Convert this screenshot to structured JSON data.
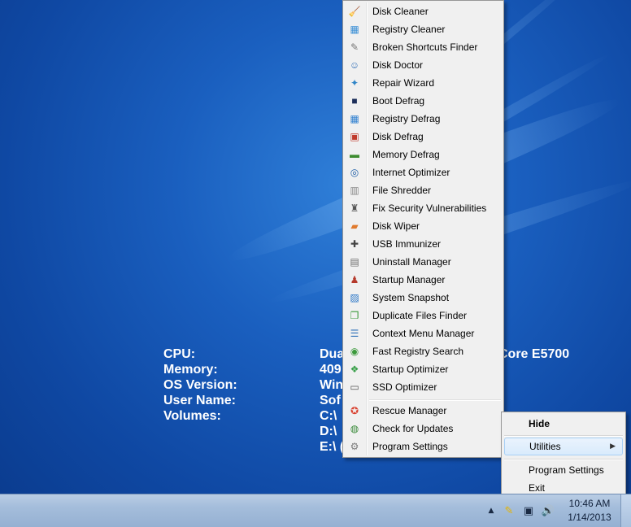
{
  "sysinfo": {
    "rows": [
      {
        "label": "CPU:",
        "value": "Dua",
        "tail": "Core    E5700"
      },
      {
        "label": "Memory:",
        "value": "409"
      },
      {
        "label": "OS Version:",
        "value": "Win"
      },
      {
        "label": "User Name:",
        "value": "Sof"
      },
      {
        "label": "Volumes:",
        "value": "C:\\"
      },
      {
        "label": "",
        "value": "D:\\"
      },
      {
        "label": "",
        "value": "E:\\ ("
      }
    ]
  },
  "utilities_menu": {
    "items": [
      {
        "label": "Disk Cleaner",
        "icon": "broom-icon",
        "glyph": "🧹",
        "color": "#c9a33a"
      },
      {
        "label": "Registry Cleaner",
        "icon": "registry-cleaner-icon",
        "glyph": "▦",
        "color": "#3a8fd6"
      },
      {
        "label": "Broken Shortcuts Finder",
        "icon": "shortcut-icon",
        "glyph": "✎",
        "color": "#777777"
      },
      {
        "label": "Disk Doctor",
        "icon": "doctor-icon",
        "glyph": "☺",
        "color": "#2f6db5"
      },
      {
        "label": "Repair Wizard",
        "icon": "wizard-icon",
        "glyph": "✦",
        "color": "#2f85c7"
      },
      {
        "label": "Boot Defrag",
        "icon": "monitor-icon",
        "glyph": "■",
        "color": "#1d2f5a"
      },
      {
        "label": "Registry Defrag",
        "icon": "registry-defrag-icon",
        "glyph": "▦",
        "color": "#2e7fd0"
      },
      {
        "label": "Disk Defrag",
        "icon": "disk-defrag-icon",
        "glyph": "▣",
        "color": "#c0392b"
      },
      {
        "label": "Memory Defrag",
        "icon": "memory-icon",
        "glyph": "▬",
        "color": "#3d8b2f"
      },
      {
        "label": "Internet Optimizer",
        "icon": "globe-icon",
        "glyph": "◎",
        "color": "#1f5fa8"
      },
      {
        "label": "File Shredder",
        "icon": "shredder-icon",
        "glyph": "▥",
        "color": "#8a8a8a"
      },
      {
        "label": "Fix Security Vulnerabilities",
        "icon": "security-icon",
        "glyph": "♜",
        "color": "#555555"
      },
      {
        "label": "Disk Wiper",
        "icon": "eraser-icon",
        "glyph": "▰",
        "color": "#e07a2d"
      },
      {
        "label": "USB Immunizer",
        "icon": "usb-icon",
        "glyph": "✚",
        "color": "#444444"
      },
      {
        "label": "Uninstall Manager",
        "icon": "uninstall-icon",
        "glyph": "▤",
        "color": "#6a6a6a"
      },
      {
        "label": "Startup Manager",
        "icon": "startup-icon",
        "glyph": "♟",
        "color": "#b5392b"
      },
      {
        "label": "System Snapshot",
        "icon": "snapshot-icon",
        "glyph": "▨",
        "color": "#2d78c8"
      },
      {
        "label": "Duplicate Files Finder",
        "icon": "duplicate-icon",
        "glyph": "❐",
        "color": "#3a9a3a"
      },
      {
        "label": "Context Menu Manager",
        "icon": "context-menu-icon",
        "glyph": "☰",
        "color": "#2c6fb8"
      },
      {
        "label": "Fast Registry Search",
        "icon": "registry-search-icon",
        "glyph": "◉",
        "color": "#3c9a3c"
      },
      {
        "label": "Startup Optimizer",
        "icon": "optimizer-icon",
        "glyph": "❖",
        "color": "#3aa04a"
      },
      {
        "label": "SSD Optimizer",
        "icon": "ssd-icon",
        "glyph": "▭",
        "color": "#555555"
      }
    ],
    "bottom_items": [
      {
        "label": "Rescue Manager",
        "icon": "lifebuoy-icon",
        "glyph": "✪",
        "color": "#d9412f"
      },
      {
        "label": "Check for Updates",
        "icon": "update-globe-icon",
        "glyph": "◍",
        "color": "#3a8a3a"
      },
      {
        "label": "Program Settings",
        "icon": "gear-icon",
        "glyph": "⚙",
        "color": "#7a7a7a"
      }
    ]
  },
  "tray_menu": {
    "hide": "Hide",
    "utilities": "Utilities",
    "program_settings": "Program Settings",
    "exit": "Exit"
  },
  "taskbar": {
    "time": "10:46 AM",
    "date": "1/14/2013",
    "tray_icons": [
      "show-hidden-icon",
      "app-tray-icon",
      "network-icon",
      "volume-icon"
    ]
  }
}
